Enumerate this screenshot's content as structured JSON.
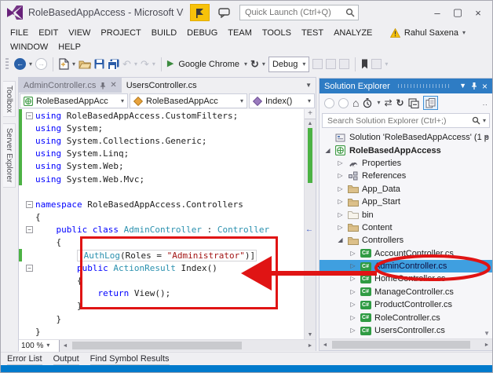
{
  "window": {
    "title": "RoleBasedAppAccess - Microsoft Visual...",
    "quick_launch_placeholder": "Quick Launch (Ctrl+Q)",
    "user_name": "Rahul Saxena"
  },
  "menu": {
    "row1": [
      "FILE",
      "EDIT",
      "VIEW",
      "PROJECT",
      "BUILD",
      "DEBUG",
      "TEAM",
      "TOOLS",
      "TEST",
      "ANALYZE"
    ],
    "row2": [
      "WINDOW",
      "HELP"
    ]
  },
  "toolbar": {
    "run_target": "Google Chrome",
    "configuration": "Debug"
  },
  "editor": {
    "tabs": [
      {
        "label": "AdminController.cs",
        "active": true
      },
      {
        "label": "UsersController.cs",
        "active": false
      }
    ],
    "breadcrumbs": [
      {
        "label": "RoleBasedAppAcc"
      },
      {
        "label": "RoleBasedAppAcc"
      },
      {
        "label": "Index()"
      }
    ],
    "zoom_value": "100 %",
    "code_lines": [
      {
        "indent": 0,
        "fold": true,
        "changed": true,
        "boxed": false,
        "tokens": [
          [
            "kw",
            "using"
          ],
          [
            "pl",
            " RoleBasedAppAccess.CustomFilters;"
          ]
        ]
      },
      {
        "indent": 0,
        "fold": false,
        "changed": true,
        "boxed": false,
        "tokens": [
          [
            "kw",
            "using"
          ],
          [
            "pl",
            " System;"
          ]
        ]
      },
      {
        "indent": 0,
        "fold": false,
        "changed": true,
        "boxed": false,
        "tokens": [
          [
            "kw",
            "using"
          ],
          [
            "pl",
            " System.Collections.Generic;"
          ]
        ]
      },
      {
        "indent": 0,
        "fold": false,
        "changed": true,
        "boxed": false,
        "tokens": [
          [
            "kw",
            "using"
          ],
          [
            "pl",
            " System.Linq;"
          ]
        ]
      },
      {
        "indent": 0,
        "fold": false,
        "changed": true,
        "boxed": false,
        "tokens": [
          [
            "kw",
            "using"
          ],
          [
            "pl",
            " System.Web;"
          ]
        ]
      },
      {
        "indent": 0,
        "fold": false,
        "changed": true,
        "boxed": false,
        "tokens": [
          [
            "kw",
            "using"
          ],
          [
            "pl",
            " System.Web.Mvc;"
          ]
        ]
      },
      {
        "indent": 0,
        "fold": false,
        "changed": false,
        "boxed": false,
        "tokens": []
      },
      {
        "indent": 0,
        "fold": true,
        "changed": false,
        "boxed": false,
        "tokens": [
          [
            "kw",
            "namespace"
          ],
          [
            "pl",
            " RoleBasedAppAccess.Controllers"
          ]
        ]
      },
      {
        "indent": 0,
        "fold": false,
        "changed": false,
        "boxed": false,
        "tokens": [
          [
            "pl",
            "{"
          ]
        ]
      },
      {
        "indent": 4,
        "fold": true,
        "changed": false,
        "boxed": false,
        "tokens": [
          [
            "kw",
            "public"
          ],
          [
            "pl",
            " "
          ],
          [
            "kw",
            "class"
          ],
          [
            "pl",
            " "
          ],
          [
            "ty",
            "AdminController"
          ],
          [
            "pl",
            " : "
          ],
          [
            "ty",
            "Controller"
          ]
        ]
      },
      {
        "indent": 4,
        "fold": false,
        "changed": false,
        "boxed": false,
        "tokens": [
          [
            "pl",
            "{"
          ]
        ]
      },
      {
        "indent": 8,
        "fold": false,
        "changed": true,
        "boxed": true,
        "tokens": [
          [
            "pl",
            "["
          ],
          [
            "ty",
            "AuthLog"
          ],
          [
            "pl",
            "(Roles = "
          ],
          [
            "str",
            "\"Administrator\""
          ],
          [
            "pl",
            ")]"
          ]
        ]
      },
      {
        "indent": 8,
        "fold": true,
        "changed": false,
        "boxed": false,
        "tokens": [
          [
            "kw",
            "public"
          ],
          [
            "pl",
            " "
          ],
          [
            "ty",
            "ActionResult"
          ],
          [
            "pl",
            " Index()"
          ]
        ]
      },
      {
        "indent": 8,
        "fold": false,
        "changed": false,
        "boxed": false,
        "tokens": [
          [
            "pl",
            "{"
          ]
        ]
      },
      {
        "indent": 12,
        "fold": false,
        "changed": false,
        "boxed": false,
        "tokens": [
          [
            "kw",
            "return"
          ],
          [
            "pl",
            " View();"
          ]
        ]
      },
      {
        "indent": 8,
        "fold": false,
        "changed": false,
        "boxed": false,
        "tokens": [
          [
            "pl",
            "}"
          ]
        ]
      },
      {
        "indent": 4,
        "fold": false,
        "changed": false,
        "boxed": false,
        "tokens": [
          [
            "pl",
            "}"
          ]
        ]
      },
      {
        "indent": 0,
        "fold": false,
        "changed": false,
        "boxed": false,
        "tokens": [
          [
            "pl",
            "}"
          ]
        ]
      }
    ]
  },
  "solution_explorer": {
    "title": "Solution Explorer",
    "search_placeholder": "Search Solution Explorer (Ctrl+;)",
    "tree": [
      {
        "label": "Solution 'RoleBasedAppAccess' (1 p",
        "icon": "solution",
        "indent": 0,
        "expander": ""
      },
      {
        "label": "RoleBasedAppAccess",
        "icon": "project",
        "indent": 0,
        "expander": "expanded",
        "bold": true
      },
      {
        "label": "Properties",
        "icon": "properties",
        "indent": 1,
        "expander": "collapsed"
      },
      {
        "label": "References",
        "icon": "references",
        "indent": 1,
        "expander": "collapsed"
      },
      {
        "label": "App_Data",
        "icon": "folder",
        "indent": 1,
        "expander": "collapsed"
      },
      {
        "label": "App_Start",
        "icon": "folder",
        "indent": 1,
        "expander": "collapsed"
      },
      {
        "label": "bin",
        "icon": "folderlight",
        "indent": 1,
        "expander": "collapsed"
      },
      {
        "label": "Content",
        "icon": "folder",
        "indent": 1,
        "expander": "collapsed"
      },
      {
        "label": "Controllers",
        "icon": "folder",
        "indent": 1,
        "expander": "expanded"
      },
      {
        "label": "AccountController.cs",
        "icon": "csharp",
        "indent": 2,
        "expander": "collapsed"
      },
      {
        "label": "AdminController.cs",
        "icon": "csharp",
        "indent": 2,
        "expander": "collapsed",
        "selected": true
      },
      {
        "label": "HomeController.cs",
        "icon": "csharp",
        "indent": 2,
        "expander": "collapsed"
      },
      {
        "label": "ManageController.cs",
        "icon": "csharp",
        "indent": 2,
        "expander": "collapsed"
      },
      {
        "label": "ProductController.cs",
        "icon": "csharp",
        "indent": 2,
        "expander": "collapsed"
      },
      {
        "label": "RoleController.cs",
        "icon": "csharp",
        "indent": 2,
        "expander": "collapsed"
      },
      {
        "label": "UsersController.cs",
        "icon": "csharp",
        "indent": 2,
        "expander": "collapsed"
      }
    ]
  },
  "bottom_tabs": [
    "Error List",
    "Output",
    "Find Symbol Results"
  ],
  "side_tabs": [
    "Toolbox",
    "Server Explorer"
  ],
  "colors": {
    "status_bar_blue": "#007ACC",
    "panel_title_blue": "#2E7CC4",
    "selection_blue": "#3F9FE0",
    "annotation_red": "#E01414",
    "keyword_blue": "#0000FF",
    "type_teal": "#2B91AF",
    "string_red": "#A31515",
    "changed_line_green": "#4CB244",
    "flag_yellow": "#F7C20A",
    "vs_logo_purple": "#68217A"
  }
}
